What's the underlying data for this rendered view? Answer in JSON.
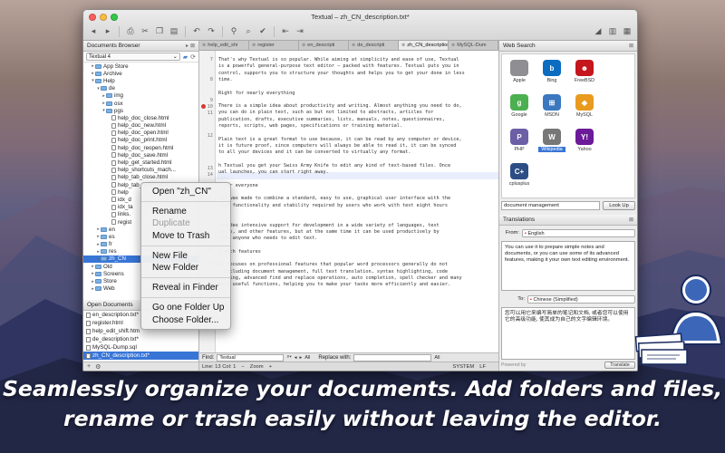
{
  "window": {
    "title": "Textual – zh_CN_description.txt*"
  },
  "toolbar": {
    "icons": [
      "back-icon",
      "forward-icon",
      "print-icon",
      "cut-icon",
      "copy-icon",
      "paste-icon",
      "undo-icon",
      "redo-icon",
      "link-icon",
      "search-icon",
      "checkmark-icon",
      "shift-left-icon",
      "shift-right-icon",
      "stats-icon",
      "layout-icon",
      "sidebar-icon"
    ]
  },
  "documents_browser": {
    "title": "Documents Browser",
    "selected_volume": "Textual 4",
    "tree": [
      {
        "label": "App Store",
        "depth": 1,
        "kind": "folder",
        "twisty": "▸"
      },
      {
        "label": "Archive",
        "depth": 1,
        "kind": "folder",
        "twisty": "▸"
      },
      {
        "label": "Help",
        "depth": 1,
        "kind": "folder",
        "twisty": "▾"
      },
      {
        "label": "de",
        "depth": 2,
        "kind": "folder",
        "twisty": "▾"
      },
      {
        "label": "img",
        "depth": 3,
        "kind": "folder",
        "twisty": "▸"
      },
      {
        "label": "osx",
        "depth": 3,
        "kind": "folder",
        "twisty": "▸"
      },
      {
        "label": "pgs",
        "depth": 3,
        "kind": "folder",
        "twisty": "▾"
      },
      {
        "label": "help_doc_close.html",
        "depth": 4,
        "kind": "file",
        "twisty": ""
      },
      {
        "label": "help_doc_new.html",
        "depth": 4,
        "kind": "file",
        "twisty": ""
      },
      {
        "label": "help_doc_open.html",
        "depth": 4,
        "kind": "file",
        "twisty": ""
      },
      {
        "label": "help_doc_print.html",
        "depth": 4,
        "kind": "file",
        "twisty": ""
      },
      {
        "label": "help_doc_reopen.html",
        "depth": 4,
        "kind": "file",
        "twisty": ""
      },
      {
        "label": "help_doc_save.html",
        "depth": 4,
        "kind": "file",
        "twisty": ""
      },
      {
        "label": "help_get_started.html",
        "depth": 4,
        "kind": "file",
        "twisty": ""
      },
      {
        "label": "help_shortcuts_mach...",
        "depth": 4,
        "kind": "file",
        "twisty": ""
      },
      {
        "label": "help_tab_close.html",
        "depth": 4,
        "kind": "file",
        "twisty": ""
      },
      {
        "label": "help_tab_move.html",
        "depth": 4,
        "kind": "file",
        "twisty": ""
      },
      {
        "label": "help",
        "depth": 4,
        "kind": "file",
        "twisty": ""
      },
      {
        "label": "idx_d",
        "depth": 4,
        "kind": "file",
        "twisty": ""
      },
      {
        "label": "idx_ta",
        "depth": 4,
        "kind": "file",
        "twisty": ""
      },
      {
        "label": "links.",
        "depth": 4,
        "kind": "file",
        "twisty": ""
      },
      {
        "label": "regist",
        "depth": 4,
        "kind": "file",
        "twisty": ""
      },
      {
        "label": "en",
        "depth": 2,
        "kind": "folder",
        "twisty": "▸"
      },
      {
        "label": "es",
        "depth": 2,
        "kind": "folder",
        "twisty": "▸"
      },
      {
        "label": "fr",
        "depth": 2,
        "kind": "folder",
        "twisty": "▸"
      },
      {
        "label": "res",
        "depth": 2,
        "kind": "folder",
        "twisty": "▸"
      },
      {
        "label": "zh_CN",
        "depth": 2,
        "kind": "folder",
        "twisty": "▸",
        "selected": true
      },
      {
        "label": "Old",
        "depth": 1,
        "kind": "folder",
        "twisty": "▸"
      },
      {
        "label": "Screens",
        "depth": 1,
        "kind": "folder",
        "twisty": "▸"
      },
      {
        "label": "Store",
        "depth": 1,
        "kind": "folder",
        "twisty": "▸"
      },
      {
        "label": "Web",
        "depth": 1,
        "kind": "folder",
        "twisty": "▸"
      }
    ]
  },
  "open_documents": {
    "title": "Open Documents",
    "items": [
      {
        "label": "en_description.txt*",
        "selected": false
      },
      {
        "label": "register.html",
        "selected": false
      },
      {
        "label": "help_edit_shift.htm",
        "selected": false
      },
      {
        "label": "de_description.txt*",
        "selected": false
      },
      {
        "label": "MySQL-Dump.sql",
        "selected": false
      },
      {
        "label": "zh_CN_description.txt*",
        "selected": true
      }
    ]
  },
  "tabs": [
    {
      "label": "help_edit_shi",
      "active": false
    },
    {
      "label": "register",
      "active": false
    },
    {
      "label": "en_descripti",
      "active": false
    },
    {
      "label": "de_descripti",
      "active": false
    },
    {
      "label": "zh_CN_description",
      "active": true
    },
    {
      "label": "MySQL-Dum",
      "active": false
    }
  ],
  "editor": {
    "line_numbers": [
      "7",
      "8",
      "9",
      "10",
      "11",
      "12",
      "13",
      "14",
      "15",
      "16",
      "17",
      "18",
      "19",
      "20",
      "21",
      "22",
      "23",
      "24",
      "25",
      "26",
      "27",
      "28",
      "29",
      "30",
      "31"
    ],
    "code_lines": [
      "That's why Textual is so popular. While aiming at simplicity and ease of use, Textual",
      "is a powerful general-purpose text editor – packed with features. Textual puts you in",
      "control, supports you to structure your thoughts and helps you to get your done in less",
      "time.",
      "",
      "Right for nearly everything",
      "",
      "There is a simple idea about productivity and writing. Almost anything you need to do,",
      "you can do in plain text, such as but not limited to abstracts, articles for",
      "publication, drafts, executive summaries, lists, manuals, notes, questionnaires,",
      "reports, scripts, web pages, specifications or training material.",
      "",
      "Plain text is a great format to use because, it can be read by any computer or device,",
      "it is future proof, since computers will always be able to read it, it can be synced",
      "to all your devices and it can be converted to virtually any format.",
      "",
      "h Textual you get your Swiss Army Knife to edit any kind of text-based files. Once",
      "ual launches, you can start right away.",
      "",
      "t for everyone",
      "",
      "ual was made to combine a standard, easy to use, graphical user interface with the",
      "ough functionality and stability required by users who work with text eight hours",
      "",
      "",
      "rovides intensive support for development in a wide variety of languages, text",
      "ssors, and other features, but at the same time it can be used productively by",
      "bout anyone who needs to edit text.",
      "",
      "d with features",
      "",
      "al focuses on professional features that popular word processors generally do not",
      ", including document management, full text translation, syntax highlighting, code",
      "folding, advanced find and replace operations, auto completion, spell checker and many",
      "more useful functions, helping you to make your tasks more efficiently and easier."
    ]
  },
  "findbar": {
    "find_label": "Find:",
    "find_value": "Textual",
    "replace_label": "Replace with:",
    "all_label": "All"
  },
  "statusbar": {
    "position": "Line: 13 Col: 1",
    "zoom": "Zoom",
    "encoding": "SYSTEM",
    "line_ending": "LF"
  },
  "context_menu": {
    "items": [
      {
        "label": "Open \"zh_CN\"",
        "disabled": false,
        "sep_after": true
      },
      {
        "label": "Rename",
        "disabled": false,
        "sep_after": false
      },
      {
        "label": "Duplicate",
        "disabled": true,
        "sep_after": false
      },
      {
        "label": "Move to Trash",
        "disabled": false,
        "sep_after": true
      },
      {
        "label": "New File",
        "disabled": false,
        "sep_after": false
      },
      {
        "label": "New Folder",
        "disabled": false,
        "sep_after": true
      },
      {
        "label": "Reveal in Finder",
        "disabled": false,
        "sep_after": true
      },
      {
        "label": "Go one Folder Up",
        "disabled": false,
        "sep_after": false
      },
      {
        "label": "Choose Folder...",
        "disabled": false,
        "sep_after": false
      }
    ]
  },
  "web_search": {
    "title": "Web Search",
    "engines": [
      {
        "label": "Apple",
        "icon": "apple-icon",
        "color": "#8e8e93",
        "glyph": "",
        "selected": false
      },
      {
        "label": "Bing",
        "icon": "bing-icon",
        "color": "#0b6cc1",
        "glyph": "b",
        "selected": false
      },
      {
        "label": "FreeBSD",
        "icon": "freebsd-icon",
        "color": "#c4161c",
        "glyph": "☻",
        "selected": false
      },
      {
        "label": "Google",
        "icon": "google-icon",
        "color": "#4caf50",
        "glyph": "g",
        "selected": false
      },
      {
        "label": "MSDN",
        "icon": "msdn-icon",
        "color": "#3b78c0",
        "glyph": "⊞",
        "selected": false
      },
      {
        "label": "MySQL",
        "icon": "mysql-icon",
        "color": "#e89b1e",
        "glyph": "◆",
        "selected": false
      },
      {
        "label": "PHP",
        "icon": "php-icon",
        "color": "#6c5fa5",
        "glyph": "P",
        "selected": false
      },
      {
        "label": "Wikipedia",
        "icon": "wikipedia-icon",
        "color": "#777777",
        "glyph": "W",
        "selected": true
      },
      {
        "label": "Yahoo",
        "icon": "yahoo-icon",
        "color": "#6b1b9a",
        "glyph": "Y!",
        "selected": false
      },
      {
        "label": "cplusplus",
        "icon": "cplusplus-icon",
        "color": "#2c4e85",
        "glyph": "C+",
        "selected": false
      }
    ],
    "query_value": "document management",
    "lookup_label": "Look Up"
  },
  "translations": {
    "title": "Translations",
    "from_label": "From:",
    "from_lang": "English",
    "source_text": "You can use it to prepare simple notes and documents, or you can use some of its advanced features, making it your own text editing environment.",
    "to_label": "To:",
    "to_lang": "Chinese (Simplified)",
    "target_text": "您可以用它来编写简单的笔记和文档, 或者您可以使用它的高级功能, 使其成为自己的文字编辑环境。",
    "powered_by": "Powered by",
    "translate_label": "Translate"
  },
  "caption": {
    "line1": "Seamlessly organize your documents. Add folders and files,",
    "line2": "rename or trash easily without leaving the editor."
  },
  "colors": {
    "selection": "#3875d7",
    "window_bg": "#ececec",
    "caption": "#ffffff"
  }
}
